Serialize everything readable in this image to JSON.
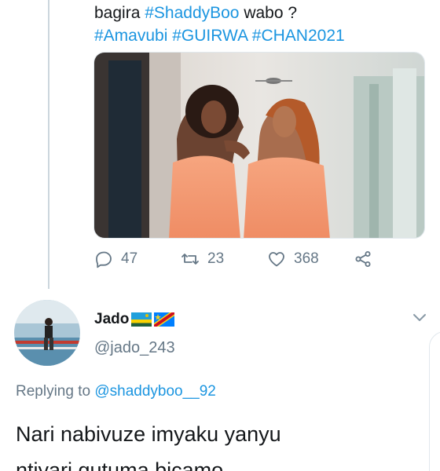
{
  "tweet": {
    "text_prefix": "bagira ",
    "mention_tag": "#ShaddyBoo",
    "text_suffix": " wabo ?",
    "hashtags": [
      "#Amavubi",
      "#GUIRWA",
      "#CHAN2021"
    ],
    "counts": {
      "replies": "47",
      "retweets": "23",
      "likes": "368"
    }
  },
  "reply": {
    "display_name": "Jado",
    "flags": [
      "rwanda-flag",
      "drc-flag"
    ],
    "handle": "@jado_243",
    "replying_prefix": "Replying to ",
    "replying_to": "@shaddyboo__92",
    "lines": [
      "Nari nabivuze imyaku yanyu",
      "ntiyari gutuma bicamo"
    ]
  },
  "colors": {
    "link": "#1b95e0",
    "muted": "#657786",
    "text": "#14171a"
  },
  "icons": {
    "reply": "reply-icon",
    "retweet": "retweet-icon",
    "like": "heart-icon",
    "share": "share-icon",
    "more": "chevron-down-icon"
  }
}
